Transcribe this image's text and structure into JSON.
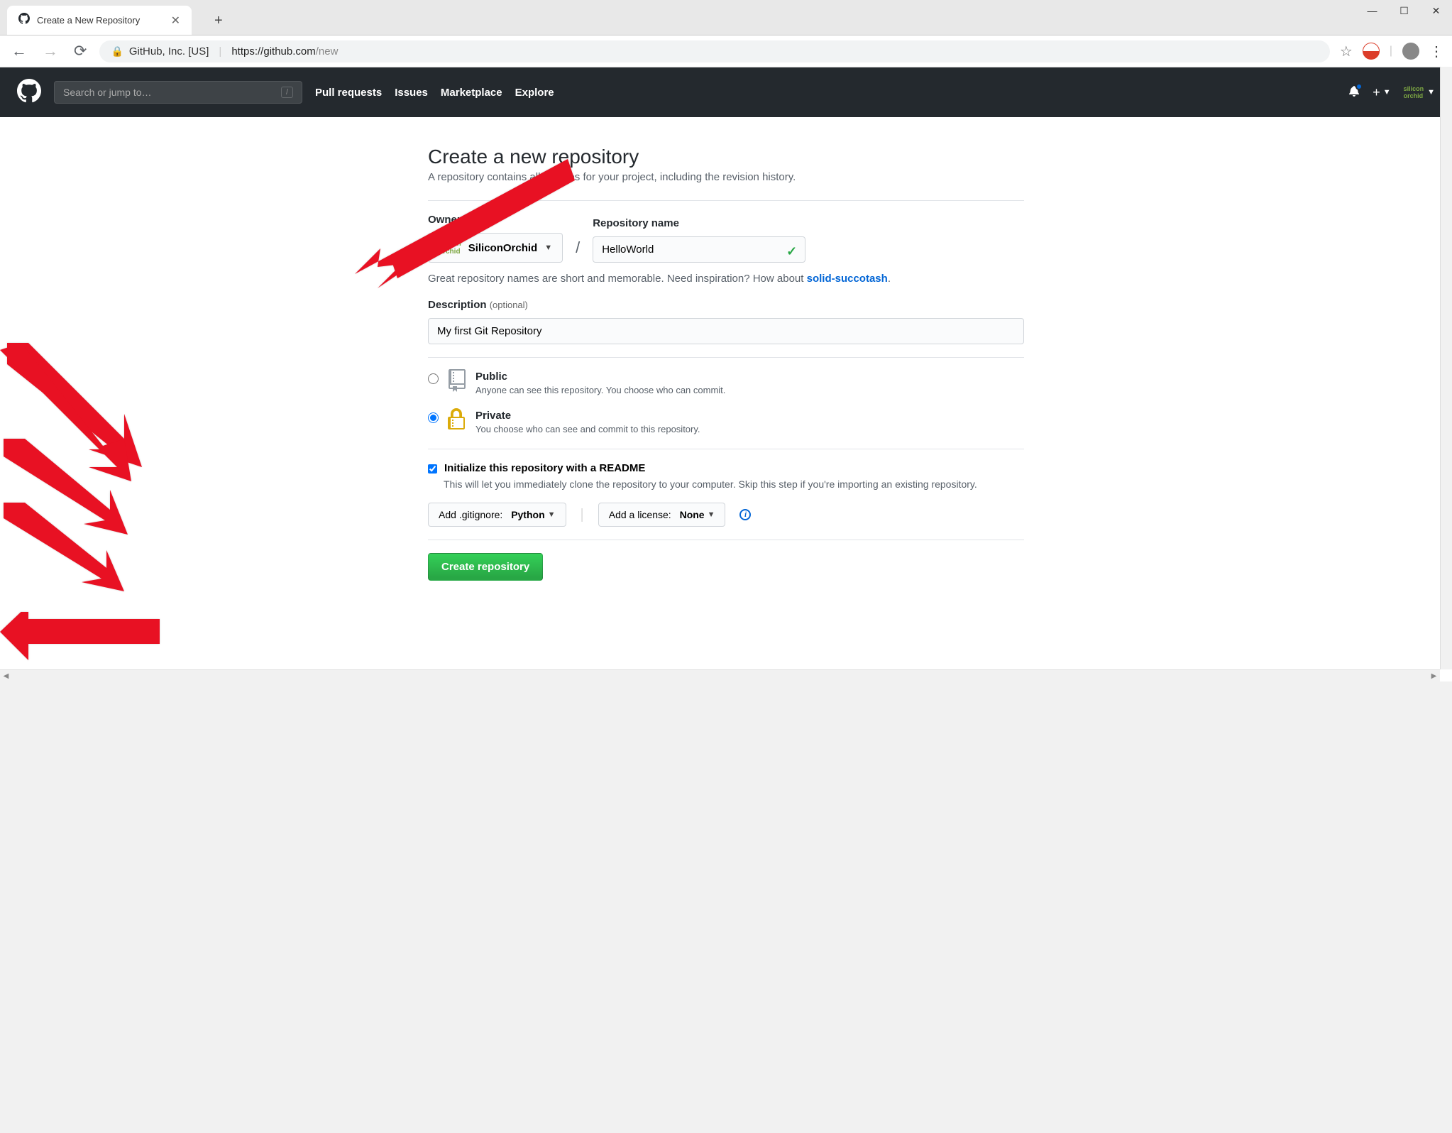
{
  "browser": {
    "tab_title": "Create a New Repository",
    "url_org": "GitHub, Inc. [US]",
    "url_domain": "https://github.com",
    "url_path": "/new"
  },
  "gh_header": {
    "search_placeholder": "Search or jump to…",
    "nav": [
      "Pull requests",
      "Issues",
      "Marketplace",
      "Explore"
    ]
  },
  "page": {
    "title": "Create a new repository",
    "subtitle": "A repository contains all the files for your project, including the revision history.",
    "owner_label": "Owner",
    "owner_value": "SiliconOrchid",
    "repo_label": "Repository name",
    "repo_value": "HelloWorld",
    "name_help_pre": "Great repository names are short and memorable. Need inspiration? How about ",
    "name_help_link": "solid-succotash",
    "desc_label": "Description",
    "desc_optional": "(optional)",
    "desc_value": "My first Git Repository",
    "public_label": "Public",
    "public_help": "Anyone can see this repository. You choose who can commit.",
    "private_label": "Private",
    "private_help": "You choose who can see and commit to this repository.",
    "readme_label": "Initialize this repository with a README",
    "readme_help": "This will let you immediately clone the repository to your computer. Skip this step if you're importing an existing repository.",
    "gitignore_label": "Add .gitignore:",
    "gitignore_value": "Python",
    "license_label": "Add a license:",
    "license_value": "None",
    "create_button": "Create repository"
  }
}
